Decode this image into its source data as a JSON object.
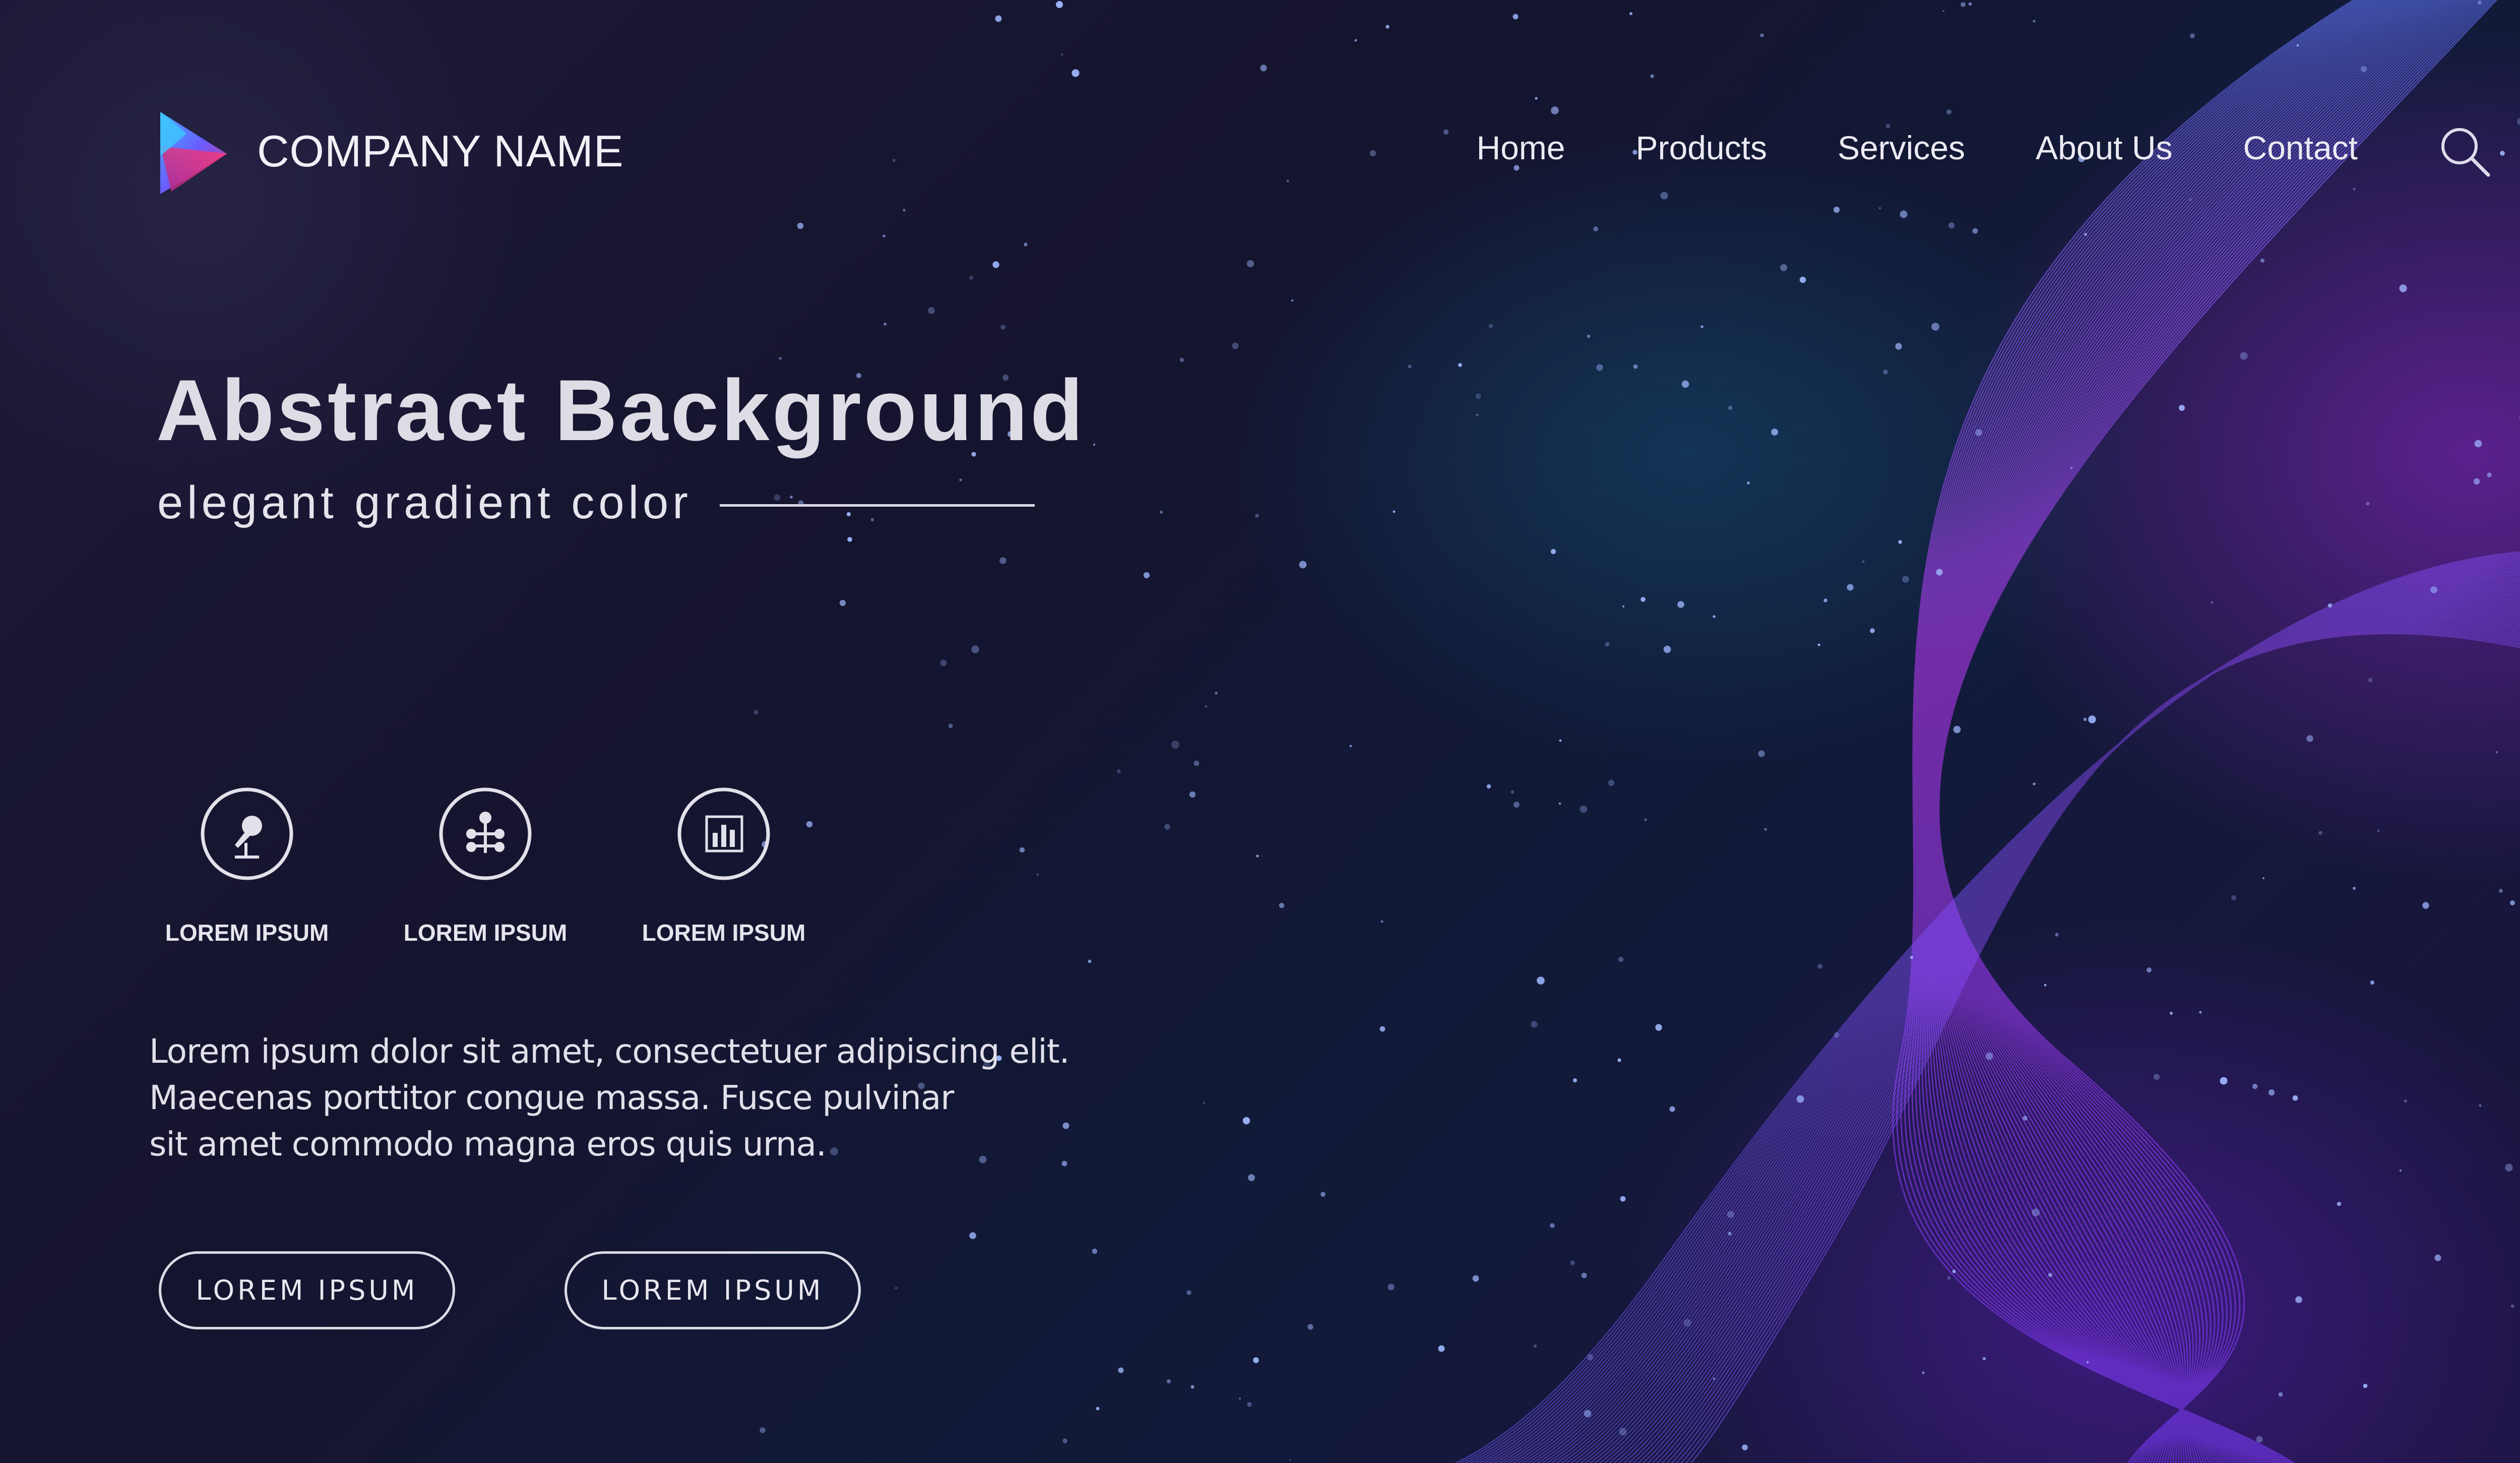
{
  "header": {
    "company_name": "COMPANY NAME",
    "nav": [
      "Home",
      "Products",
      "Services",
      "About Us",
      "Contact"
    ],
    "search_icon": "search-icon"
  },
  "hero": {
    "title": "Abstract Background",
    "subtitle": "elegant gradient color"
  },
  "features": [
    {
      "icon": "microphone-icon",
      "label": "LOREM IPSUM"
    },
    {
      "icon": "network-icon",
      "label": "LOREM IPSUM"
    },
    {
      "icon": "bar-chart-icon",
      "label": "LOREM IPSUM"
    }
  ],
  "body": {
    "lines": [
      "Lorem ipsum dolor sit amet, consectetuer adipiscing elit.",
      "Maecenas porttitor congue massa. Fusce pulvinar",
      "sit amet commodo magna eros quis urna."
    ]
  },
  "buttons": [
    "LOREM IPSUM",
    "LOREM IPSUM"
  ],
  "colors": {
    "background": "#15142e",
    "accent_purple": "#a63cf0",
    "accent_blue": "#4a7dff",
    "text": "#e5e4ec"
  }
}
